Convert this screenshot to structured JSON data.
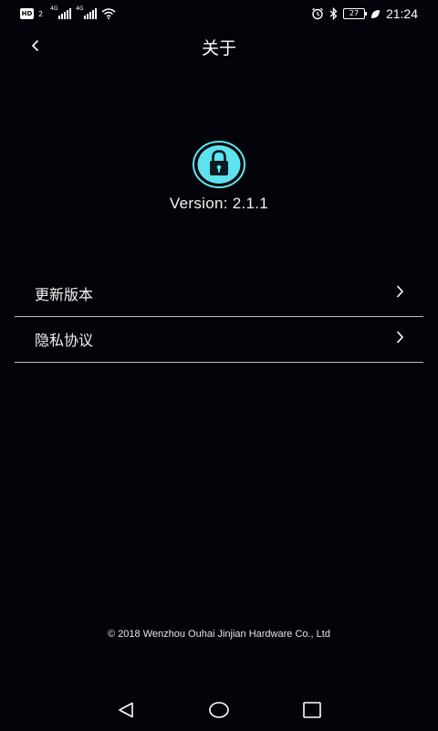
{
  "status_bar": {
    "hd_label": "HD",
    "sim1_number": "2",
    "sim1_network": "4G",
    "sim2_network": "4G",
    "battery_level": "27",
    "time": "21:24",
    "icons": [
      "wifi-icon",
      "alarm-icon",
      "bluetooth-icon",
      "leaf-icon"
    ]
  },
  "header": {
    "title": "关于",
    "back_icon": "chevron-left-icon"
  },
  "about": {
    "logo_icon": "lock-icon",
    "logo_color": "#5ee3ee",
    "version": "Version: 2.1.1"
  },
  "menu": {
    "items": [
      {
        "label": "更新版本",
        "icon": "chevron-right-icon"
      },
      {
        "label": "隐私协议",
        "icon": "chevron-right-icon"
      }
    ]
  },
  "footer": {
    "copyright": "© 2018 Wenzhou Ouhai Jinjian Hardware Co., Ltd"
  },
  "nav_bar": {
    "icons": [
      "nav-back-icon",
      "nav-home-icon",
      "nav-recent-icon"
    ]
  },
  "colors": {
    "background": "#020409",
    "text": "#ffffff",
    "divider": "#b9bcc2",
    "accent": "#5ee3ee"
  }
}
